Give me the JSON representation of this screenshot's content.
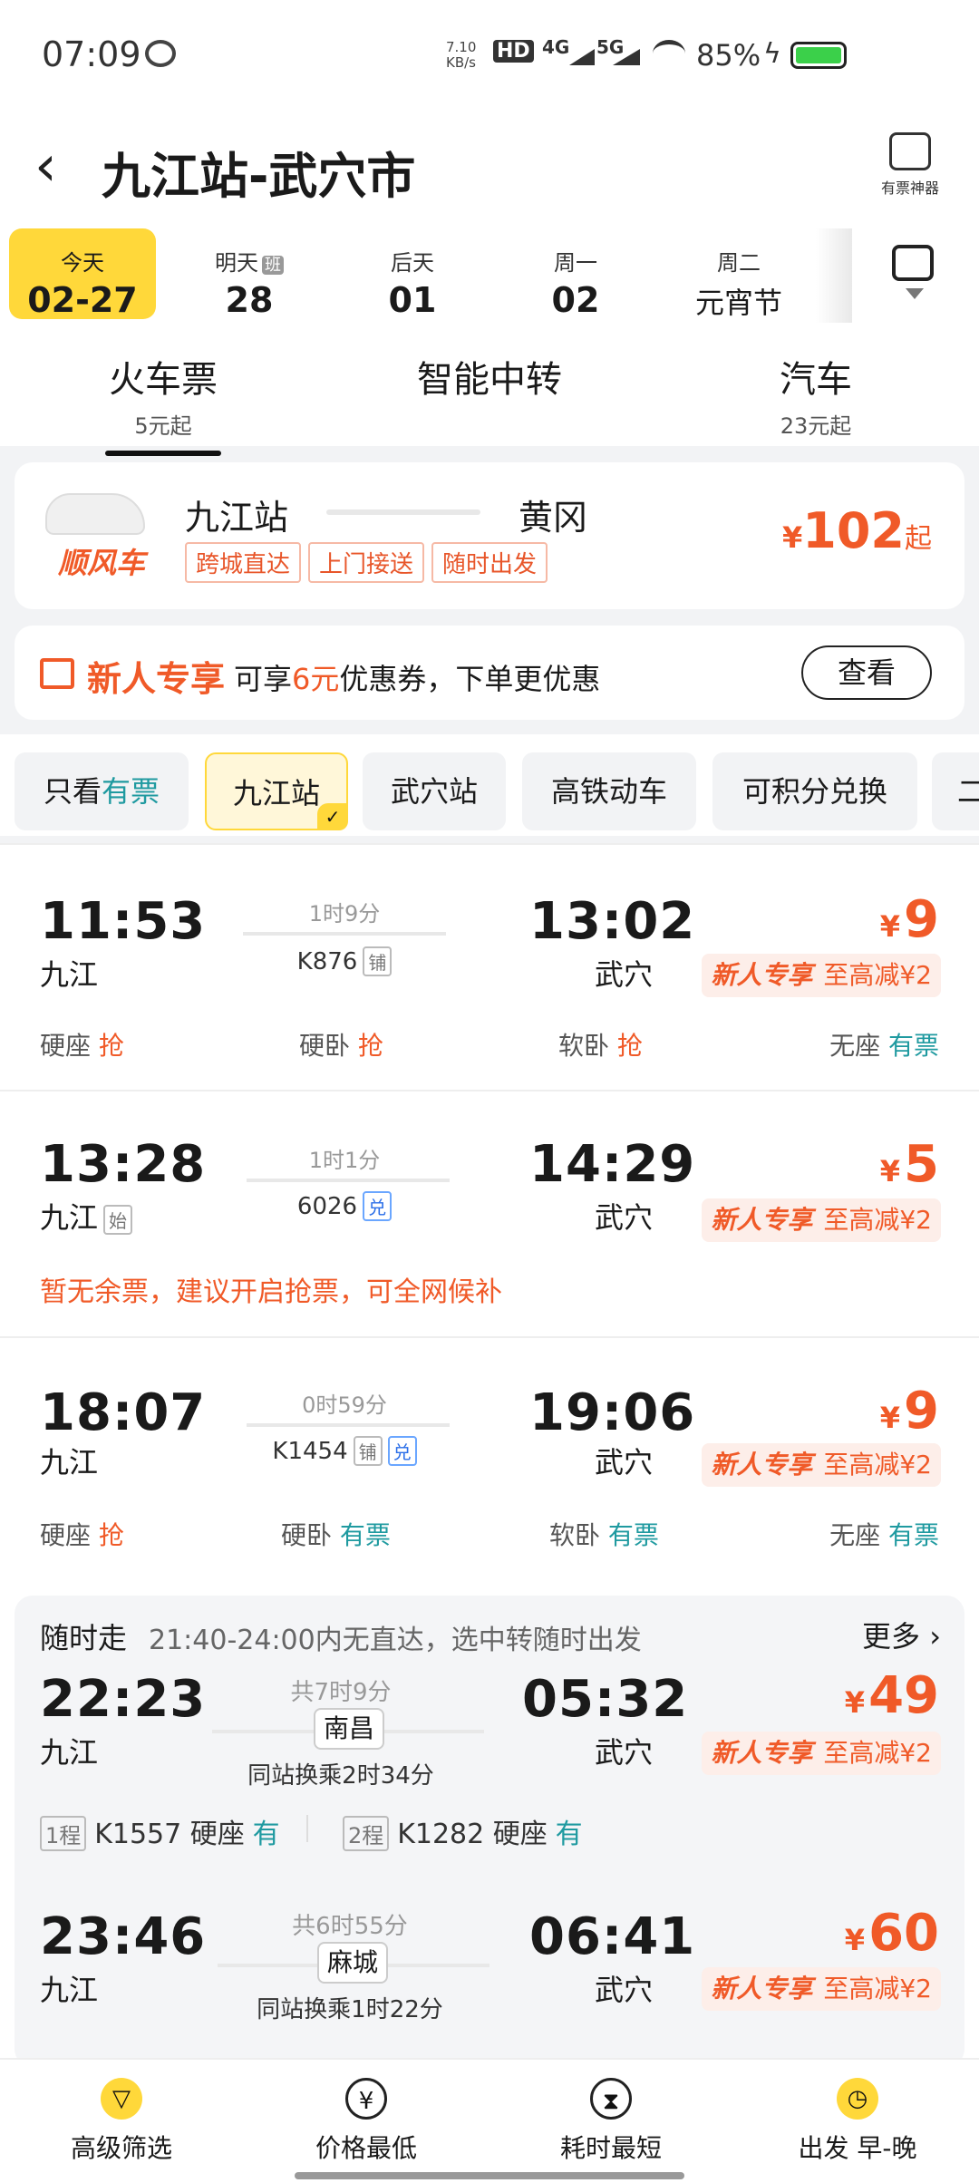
{
  "status": {
    "time": "07:09",
    "net_speed": "7.10 KB/s",
    "hd": "HD",
    "g4": "4G",
    "g5": "5G",
    "battery": "85%"
  },
  "header": {
    "title": "九江站-武穴市",
    "tool_label": "有票神器"
  },
  "dates": [
    {
      "top": "今天",
      "bottom": "02-27"
    },
    {
      "top": "明天",
      "badge": "班",
      "bottom": "28"
    },
    {
      "top": "后天",
      "bottom": "01"
    },
    {
      "top": "周一",
      "bottom": "02"
    },
    {
      "top": "周二",
      "bottom": "元宵节"
    }
  ],
  "modes": [
    {
      "label": "火车票",
      "sub": "5元起"
    },
    {
      "label": "智能中转",
      "sub": ""
    },
    {
      "label": "汽车",
      "sub": "23元起"
    }
  ],
  "carpool": {
    "brand": "顺风车",
    "from": "九江站",
    "to": "黄冈",
    "tags": [
      "跨城直达",
      "上门接送",
      "随时出发"
    ],
    "price_symbol": "¥",
    "price": "102",
    "price_suffix": "起"
  },
  "newuser": {
    "title": "新人专享",
    "text_pre": "可享",
    "amount": "6元",
    "text_post": "优惠券，下单更优惠",
    "button": "查看"
  },
  "filters": {
    "only": "只看",
    "only_hl": "有票",
    "items": [
      "九江站",
      "武穴站",
      "高铁动车",
      "可积分兑换",
      "二"
    ]
  },
  "trains": [
    {
      "dep": "11:53",
      "dep_sta": "九江",
      "dur": "1时9分",
      "num": "K876",
      "tags": [
        "铺"
      ],
      "arr": "13:02",
      "arr_sta": "武穴",
      "price": "9",
      "promo_a": "新人专享",
      "promo_b": "至高减¥2",
      "seats": [
        {
          "name": "硬座",
          "st": "抢"
        },
        {
          "name": "硬卧",
          "st": "抢"
        },
        {
          "name": "软卧",
          "st": "抢"
        },
        {
          "name": "无座",
          "st": "有票"
        }
      ]
    },
    {
      "dep": "13:28",
      "dep_sta": "九江",
      "dep_tag": "始",
      "dur": "1时1分",
      "num": "6026",
      "tags": [
        "兑"
      ],
      "arr": "14:29",
      "arr_sta": "武穴",
      "price": "5",
      "promo_a": "新人专享",
      "promo_b": "至高减¥2",
      "note": "暂无余票，建议开启抢票，可全网候补"
    },
    {
      "dep": "18:07",
      "dep_sta": "九江",
      "dur": "0时59分",
      "num": "K1454",
      "tags": [
        "铺",
        "兑"
      ],
      "arr": "19:06",
      "arr_sta": "武穴",
      "price": "9",
      "promo_a": "新人专享",
      "promo_b": "至高减¥2",
      "seats": [
        {
          "name": "硬座",
          "st": "抢"
        },
        {
          "name": "硬卧",
          "st": "有票"
        },
        {
          "name": "软卧",
          "st": "有票"
        },
        {
          "name": "无座",
          "st": "有票"
        }
      ]
    }
  ],
  "transfer": {
    "title": "随时走",
    "desc": "21:40-24:00内无直达，选中转随时出发",
    "more": "更多",
    "items": [
      {
        "dep": "22:23",
        "dep_sta": "九江",
        "total": "共7时9分",
        "via": "南昌",
        "change": "同站换乘2时34分",
        "arr": "05:32",
        "arr_sta": "武穴",
        "price": "49",
        "promo_a": "新人专享",
        "promo_b": "至高减¥2",
        "leg1_tag": "1程",
        "leg1": "K1557 硬座",
        "leg1_st": "有",
        "leg2_tag": "2程",
        "leg2": "K1282 硬座",
        "leg2_st": "有"
      },
      {
        "dep": "23:46",
        "dep_sta": "九江",
        "total": "共6时55分",
        "via": "麻城",
        "change": "同站换乘1时22分",
        "arr": "06:41",
        "arr_sta": "武穴",
        "price": "60",
        "promo_a": "新人专享",
        "promo_b": "至高减¥2"
      }
    ]
  },
  "tabbar": [
    {
      "label": "高级筛选",
      "icon": "filter-icon"
    },
    {
      "label": "价格最低",
      "icon": "yuan-icon"
    },
    {
      "label": "耗时最短",
      "icon": "hourglass-icon"
    },
    {
      "label": "出发 早-晚",
      "icon": "clock-icon"
    }
  ]
}
